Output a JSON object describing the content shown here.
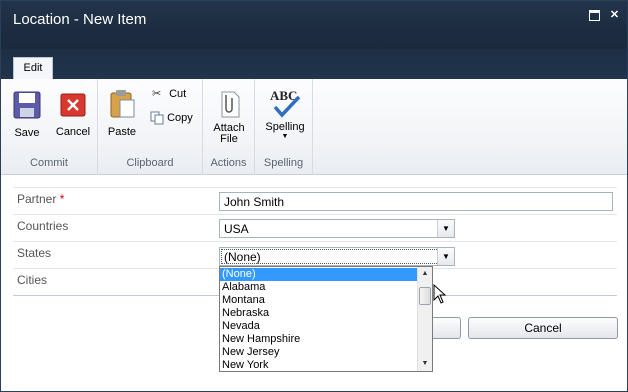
{
  "window": {
    "title": "Location - New Item",
    "maximize_icon": "maximize-icon",
    "close_icon": "close-icon",
    "close_glyph": "✕"
  },
  "ribbon": {
    "tab_label": "Edit",
    "groups": {
      "commit": {
        "label": "Commit",
        "save_label": "Save",
        "cancel_label": "Cancel"
      },
      "clipboard": {
        "label": "Clipboard",
        "paste_label": "Paste",
        "cut_label": "Cut",
        "copy_label": "Copy"
      },
      "actions": {
        "label": "Actions",
        "attach_line1": "Attach",
        "attach_line2": "File"
      },
      "spelling": {
        "label": "Spelling",
        "spelling_label": "Spelling",
        "abc_text": "ABC"
      }
    }
  },
  "form": {
    "partner": {
      "label": "Partner",
      "required_mark": "*",
      "value": "John Smith"
    },
    "countries": {
      "label": "Countries",
      "value": "USA"
    },
    "states": {
      "label": "States",
      "value": "(None)"
    },
    "cities": {
      "label": "Cities"
    },
    "states_options": [
      "(None)",
      "Alabama",
      "Montana",
      "Nebraska",
      "Nevada",
      "New Hampshire",
      "New Jersey",
      "New York"
    ],
    "states_selected_index": 0
  },
  "buttons": {
    "save_label": "",
    "cancel_label": "Cancel"
  },
  "colors": {
    "titlebar": "#1d2c40",
    "selected_option": "#3399ff",
    "required": "#dd0000"
  }
}
